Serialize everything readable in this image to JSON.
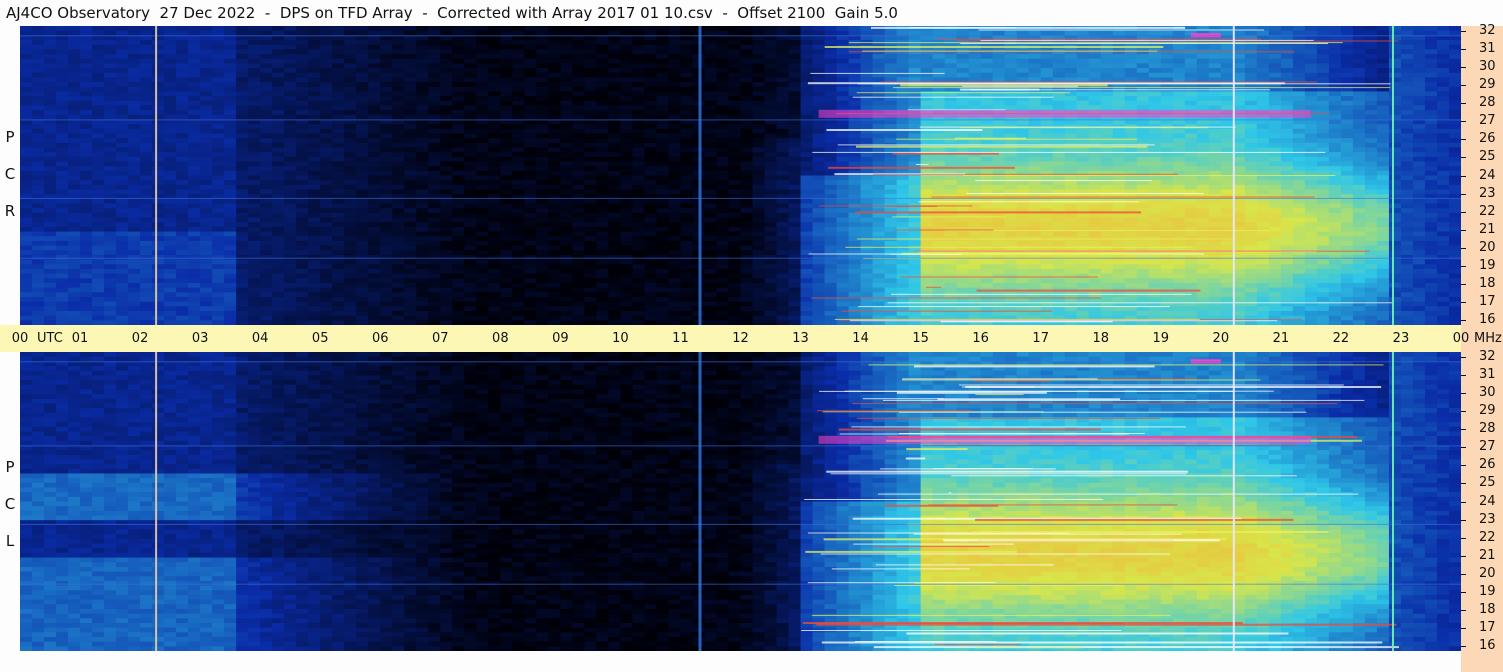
{
  "title": "AJ4CO Observatory  27 Dec 2022  -  DPS on TFD Array  -  Corrected with Array 2017 01 10.csv  -  Offset 2100  Gain 5.0",
  "chart_data": {
    "type": "heatmap",
    "title": "AJ4CO Observatory  27 Dec 2022  -  DPS on TFD Array  -  Corrected with Array 2017 01 10.csv  -  Offset 2100  Gain 5.0",
    "x_axis": {
      "unit_label": "UTC",
      "range_hours": [
        0,
        24
      ],
      "tick_labels": [
        "00",
        "01",
        "02",
        "03",
        "04",
        "05",
        "06",
        "07",
        "08",
        "09",
        "10",
        "11",
        "12",
        "13",
        "14",
        "15",
        "16",
        "17",
        "18",
        "19",
        "20",
        "21",
        "22",
        "23",
        "00"
      ]
    },
    "y_axis": {
      "unit_label": "MHz",
      "range_mhz": [
        16,
        32
      ],
      "tick_labels": [
        "32",
        "31",
        "30",
        "29",
        "28",
        "27",
        "26",
        "25",
        "24",
        "23",
        "22",
        "21",
        "20",
        "19",
        "18",
        "17",
        "16"
      ]
    },
    "panels": [
      {
        "name": "RCP",
        "letters": [
          "P",
          "C",
          "R"
        ]
      },
      {
        "name": "LCP",
        "letters": [
          "P",
          "C",
          "L"
        ]
      }
    ],
    "colors": {
      "background_low": "#000008",
      "band_blue": "#0a2ca8",
      "mid_cyan": "#2fc7e8",
      "high_yellow": "#d8e64a",
      "peak_orange": "#f2b23a",
      "saturated": "#ff40c8",
      "axis_band": "#fdf7b6",
      "right_panel": "#fcd8b6"
    },
    "features": {
      "quiet_night_start_hour": 3.55,
      "quiet_night_end_hour": 13.0,
      "daytime_noise_rise_hour": 13.0,
      "full_daytime_hour": 15.0,
      "vertical_markers_hours": [
        2.25,
        11.3,
        20.2,
        22.85
      ],
      "burst_frequency_mhz": 31.5,
      "burst_hours": [
        19.5,
        20.0
      ]
    }
  }
}
